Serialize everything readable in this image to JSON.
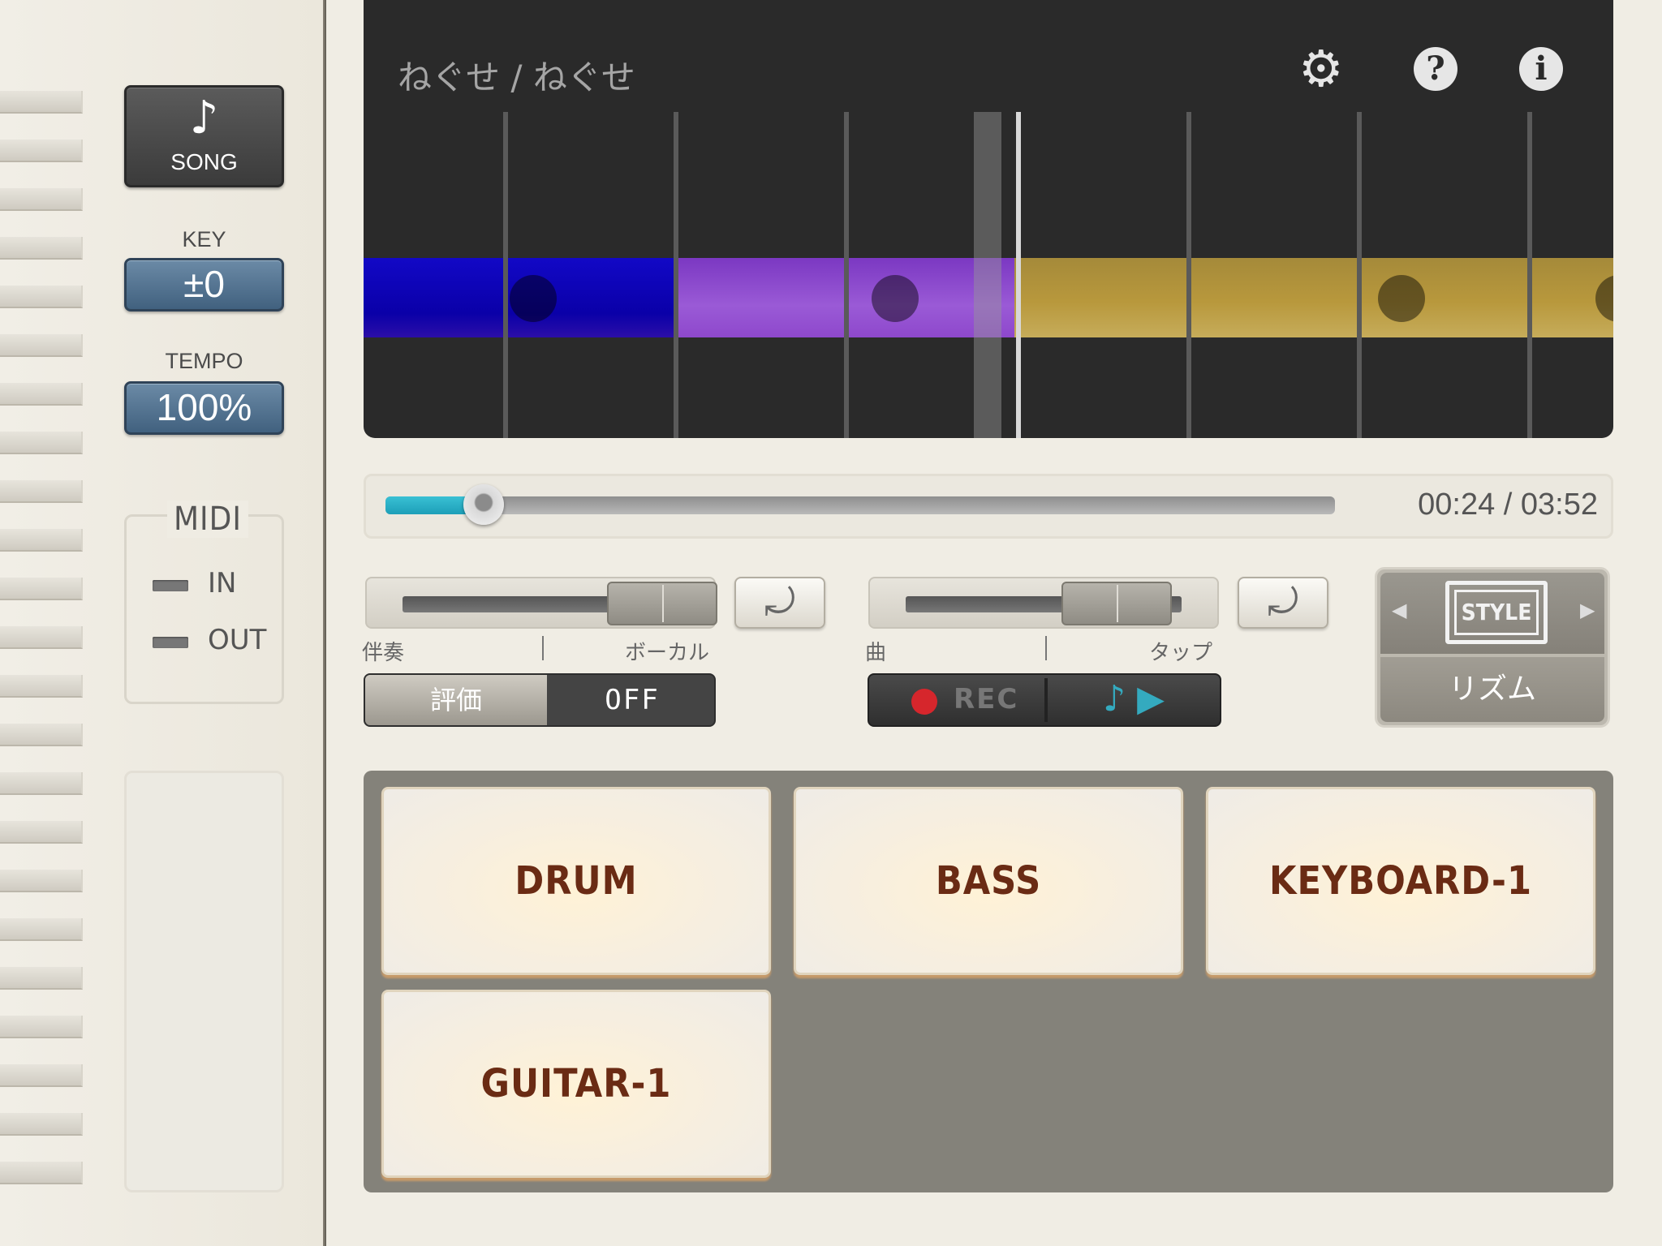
{
  "sidebar": {
    "song_icon": "♪",
    "song_label": "SONG",
    "key_label": "KEY",
    "key_value": "±0",
    "tempo_label": "TEMPO",
    "tempo_value": "100%",
    "midi_title": "MIDI",
    "midi_in": "IN",
    "midi_out": "OUT"
  },
  "display": {
    "song_title": "ねぐせ / ねぐせ",
    "settings_icon": "gear-icon",
    "help_icon": "help-icon",
    "info_icon": "info-icon",
    "help_glyph": "?",
    "info_glyph": "i",
    "gear_glyph": "⚙",
    "colors": {
      "section_1": "#1208c6",
      "section_2": "#8e48cc",
      "section_3": "#b8983c"
    }
  },
  "progress": {
    "fraction": 0.103,
    "time": "00:24 / 03:52"
  },
  "balance_left": {
    "left_label": "伴奏",
    "right_label": "ボーカル",
    "reset_glyph": "⤾"
  },
  "balance_right": {
    "left_label": "曲",
    "right_label": "タップ",
    "reset_glyph": "⤾"
  },
  "score_toggle": {
    "label": "評価",
    "state": "OFF"
  },
  "recorder": {
    "rec_label": "REC",
    "play_glyph": "♪ ▶"
  },
  "style": {
    "badge": "STYLE",
    "rhythm_label": "リズム",
    "prev_glyph": "◀",
    "next_glyph": "▶"
  },
  "parts": [
    "DRUM",
    "BASS",
    "KEYBOARD-1",
    "GUITAR-1"
  ]
}
